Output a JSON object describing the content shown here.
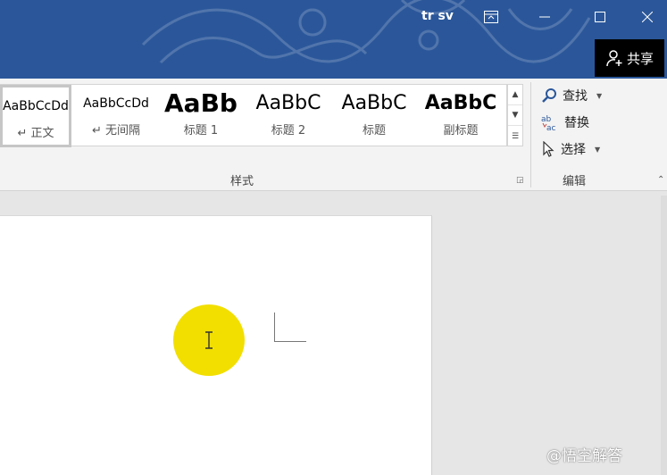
{
  "titlebar": {
    "user": "tr sv",
    "share_label": "共享"
  },
  "styles_gallery": {
    "items": [
      {
        "sample": "AaBbCcDd",
        "name": "↵ 正文"
      },
      {
        "sample": "AaBbCcDd",
        "name": "↵ 无间隔"
      },
      {
        "sample": "AaBb",
        "name": "标题 1"
      },
      {
        "sample": "AaBbC",
        "name": "标题 2"
      },
      {
        "sample": "AaBbC",
        "name": "标题"
      },
      {
        "sample": "AaBbC",
        "name": "副标题"
      }
    ],
    "group_label": "样式"
  },
  "editing": {
    "find": "查找",
    "replace": "替换",
    "select": "选择",
    "group_label": "编辑"
  },
  "watermark": "@悟空解答",
  "colors": {
    "titlebar": "#2b579a",
    "highlight": "#f2df00"
  }
}
